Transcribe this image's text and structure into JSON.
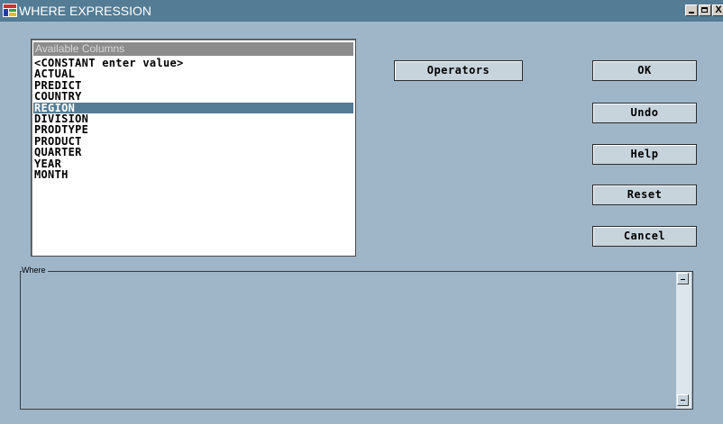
{
  "window": {
    "title": "WHERE EXPRESSION",
    "icon": "sas-app-icon",
    "controls": {
      "minimize": "minimize-icon",
      "maximize": "maximize-icon",
      "close": "X"
    }
  },
  "columns": {
    "header": "Available Columns",
    "items": [
      "<CONSTANT enter value>",
      "ACTUAL",
      "PREDICT",
      "COUNTRY",
      "REGION",
      "DIVISION",
      "PRODTYPE",
      "PRODUCT",
      "QUARTER",
      "YEAR",
      "MONTH"
    ],
    "selected": "REGION"
  },
  "buttons": {
    "operators": "Operators",
    "ok": "OK",
    "undo": "Undo",
    "help": "Help",
    "reset": "Reset",
    "cancel": "Cancel"
  },
  "where": {
    "label": "Where",
    "value": ""
  },
  "colors": {
    "background": "#9fb6c9",
    "titlebar": "#547c94",
    "selection": "#547c94"
  }
}
